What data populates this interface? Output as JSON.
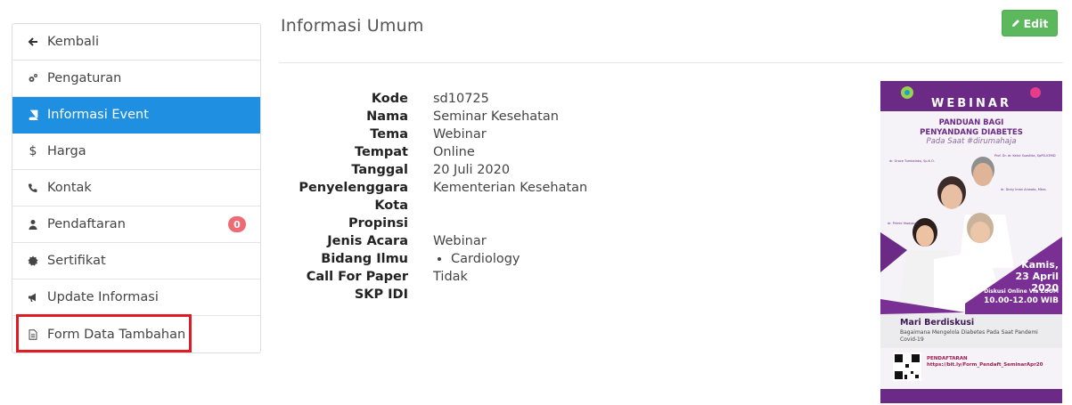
{
  "sidebar": {
    "items": [
      {
        "label": "Kembali",
        "icon": "arrow-left-icon"
      },
      {
        "label": "Pengaturan",
        "icon": "cogs-icon"
      },
      {
        "label": "Informasi Event",
        "icon": "book-icon",
        "active": true
      },
      {
        "label": "Harga",
        "icon": "dollar-icon"
      },
      {
        "label": "Kontak",
        "icon": "phone-icon"
      },
      {
        "label": "Pendaftaran",
        "icon": "user-icon",
        "badge": "0"
      },
      {
        "label": "Sertifikat",
        "icon": "certificate-icon"
      },
      {
        "label": "Update Informasi",
        "icon": "bullhorn-icon"
      },
      {
        "label": "Form Data Tambahan",
        "icon": "file-text-icon"
      }
    ]
  },
  "header": {
    "title": "Informasi Umum",
    "edit_label": "Edit"
  },
  "info": {
    "labels": {
      "kode": "Kode",
      "nama": "Nama",
      "tema": "Tema",
      "tempat": "Tempat",
      "tanggal": "Tanggal",
      "penyelenggara": "Penyelenggara",
      "kota": "Kota",
      "propinsi": "Propinsi",
      "jenis_acara": "Jenis Acara",
      "bidang_ilmu": "Bidang Ilmu",
      "call_for_paper": "Call For Paper",
      "skp_idi": "SKP IDI"
    },
    "values": {
      "kode": "sd10725",
      "nama": "Seminar Kesehatan",
      "tema": "Webinar",
      "tempat": "Online",
      "tanggal": "20 Juli 2020",
      "penyelenggara": "Kementerian Kesehatan",
      "kota": "",
      "propinsi": "",
      "jenis_acara": "Webinar",
      "bidang_ilmu": [
        "Cardiology"
      ],
      "call_for_paper": "Tidak",
      "skp_idi": ""
    }
  },
  "poster": {
    "heading": "WEBINAR",
    "title_line1": "PANDUAN BAGI",
    "title_line2": "PENYANDANG DIABETES",
    "subtitle": "Pada Saat #dirumahaja",
    "date_line1": "Kamis,",
    "date_line2": "23 April 2020",
    "zoom_line": "Diskusi Online Via ZOOM",
    "time_line": "10.00-12.00 WIB",
    "mari": "Mari Berdiskusi",
    "mari_sub": "Bagaimana Mengelola Diabetes Pada Saat Pandemi Covid-19",
    "daftar_label": "PENDAFTARAN",
    "daftar_link": "https://bit.ly/Form_Pendaft_SeminarApr20",
    "speakers": [
      "dr. Grace Tumbelaka, Sp.K.O.",
      "Prof. Dr. dr. Ketut Suastika, SpPD-KEMD",
      "dr. Dicky Iman Ariwata, Mkes",
      "dr. Primie Yasepson"
    ]
  },
  "colors": {
    "active": "#1e8fe1",
    "edit": "#5cb85c",
    "badge": "#ef6b73",
    "highlight": "#e01b24",
    "poster_purple": "#6b2a85"
  }
}
